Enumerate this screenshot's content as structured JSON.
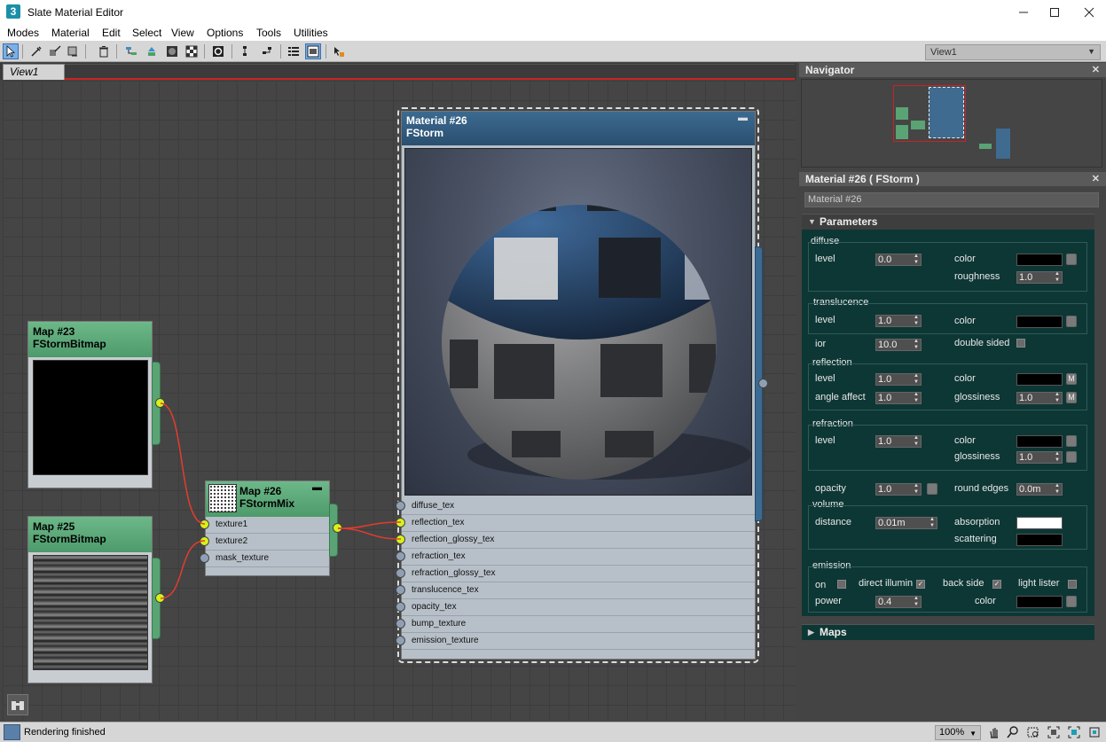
{
  "window": {
    "title": "Slate Material Editor",
    "app_icon": "3"
  },
  "menu": [
    "Modes",
    "Material",
    "Edit",
    "Select",
    "View",
    "Options",
    "Tools",
    "Utilities"
  ],
  "toolbar": {
    "view_dropdown": "View1"
  },
  "tabs": {
    "active": "View1"
  },
  "nodes": {
    "map23": {
      "title": "Map #23",
      "type": "FStormBitmap"
    },
    "map25": {
      "title": "Map #25",
      "type": "FStormBitmap"
    },
    "map26": {
      "title": "Map #26",
      "type": "FStormMix",
      "slots": [
        "texture1",
        "texture2",
        "mask_texture"
      ],
      "slot_connected": [
        true,
        true,
        false
      ]
    },
    "material26": {
      "title": "Material #26",
      "type": "FStorm",
      "slots": [
        "diffuse_tex",
        "reflection_tex",
        "reflection_glossy_tex",
        "refraction_tex",
        "refraction_glossy_tex",
        "translucence_tex",
        "opacity_tex",
        "bump_texture",
        "emission_texture"
      ],
      "slot_connected": [
        false,
        true,
        true,
        false,
        false,
        false,
        false,
        false,
        false
      ]
    }
  },
  "navigator": {
    "title": "Navigator"
  },
  "inspector": {
    "title": "Material #26  ( FStorm )",
    "name_field": "Material #26",
    "params_title": "Parameters",
    "maps_title": "Maps",
    "diffuse": {
      "group": "diffuse",
      "level_label": "level",
      "level": "0.0",
      "color_label": "color",
      "roughness_label": "roughness",
      "roughness": "1.0"
    },
    "translucence": {
      "group": "translucence",
      "level_label": "level",
      "level": "1.0",
      "color_label": "color",
      "ior_label": "ior",
      "ior": "10.0",
      "double_sided_label": "double sided"
    },
    "reflection": {
      "group": "reflection",
      "level_label": "level",
      "level": "1.0",
      "color_label": "color",
      "angle_affect_label": "angle affect",
      "angle_affect": "1.0",
      "glossiness_label": "glossiness",
      "glossiness": "1.0",
      "m_label": "M"
    },
    "refraction": {
      "group": "refraction",
      "level_label": "level",
      "level": "1.0",
      "color_label": "color",
      "glossiness_label": "glossiness",
      "glossiness": "1.0"
    },
    "opacity": {
      "label": "opacity",
      "value": "1.0",
      "round_edges_label": "round edges",
      "round_edges": "0.0m"
    },
    "volume": {
      "group": "volume",
      "distance_label": "distance",
      "distance": "0.01m",
      "absorption_label": "absorption",
      "scattering_label": "scattering"
    },
    "emission": {
      "group": "emission",
      "on_label": "on",
      "direct_illum_label": "direct illumin",
      "back_side_label": "back side",
      "light_lister_label": "light lister",
      "power_label": "power",
      "power": "0.4",
      "color_label": "color",
      "check_mark": "✓"
    }
  },
  "status": {
    "text": "Rendering finished",
    "zoom": "100%"
  },
  "colors": {
    "node_green": "#5aa374",
    "node_blue": "#2a4f70",
    "wire": "#e53c2e",
    "port_on": "#d6f21a",
    "panel_bg": "#0d3735"
  }
}
